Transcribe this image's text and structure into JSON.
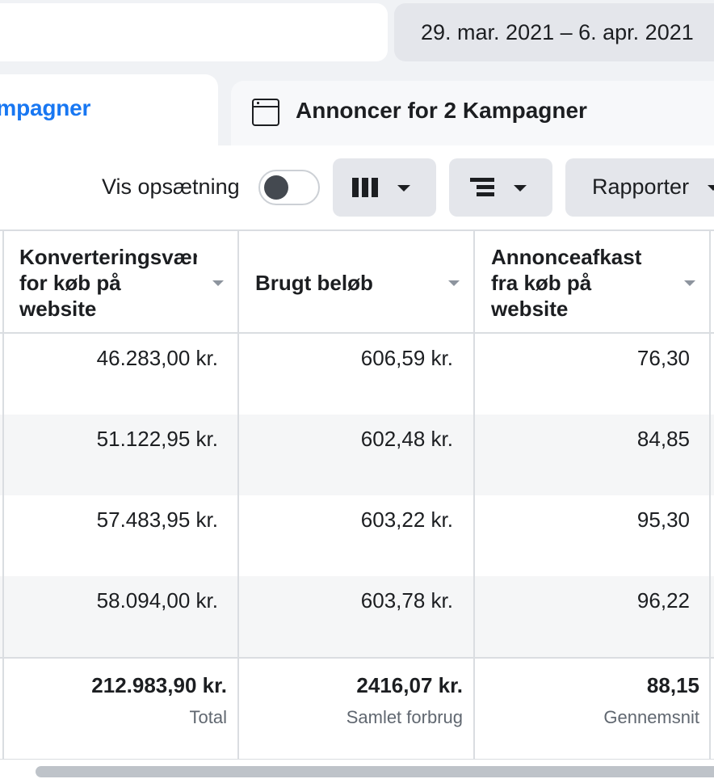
{
  "header": {
    "search_value": "",
    "date_range": "29. mar. 2021 – 6. apr. 2021"
  },
  "tabs": [
    {
      "label": "Kampagner",
      "active": true
    },
    {
      "label": "Annoncer for 2 Kampagner",
      "active": false
    }
  ],
  "toolbar": {
    "setup_toggle_label": "Vis opsætning",
    "setup_toggle_on": false,
    "columns_icon": "columns-icon",
    "breakdown_icon": "breakdown-icon",
    "reports_label": "Rapporter"
  },
  "table": {
    "columns": [
      {
        "label": "Konverteringsværdi\nfor køb på\nwebsite"
      },
      {
        "label": "Brugt beløb"
      },
      {
        "label": "Annonceafkast\nfra køb på\nwebsite"
      }
    ],
    "rows": [
      [
        "46.283,00 kr.",
        "606,59 kr.",
        "76,30"
      ],
      [
        "51.122,95 kr.",
        "602,48 kr.",
        "84,85"
      ],
      [
        "57.483,95 kr.",
        "603,22 kr.",
        "95,30"
      ],
      [
        "58.094,00 kr.",
        "603,78 kr.",
        "96,22"
      ]
    ],
    "totals": [
      {
        "value": "212.983,90 kr.",
        "label": "Total"
      },
      {
        "value": "2416,07 kr.",
        "label": "Samlet forbrug"
      },
      {
        "value": "88,15",
        "label": "Gennemsnit"
      }
    ]
  },
  "colors": {
    "accent": "#1877f2",
    "background": "#f0f2f5",
    "button_bg": "#e4e6eb"
  }
}
